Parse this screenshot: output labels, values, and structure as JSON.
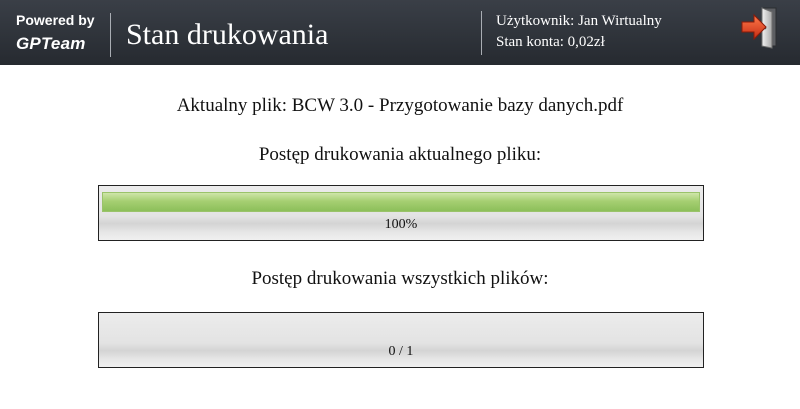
{
  "header": {
    "powered_by": "Powered by",
    "logo_text": "GPTeam",
    "title": "Stan drukowania",
    "user_line": "Użytkownik: Jan Wirtualny",
    "balance_line": "Stan konta: 0,02zł",
    "exit_icon": "exit-door-icon",
    "exit_icon_colors": {
      "door": "#d4d4d4",
      "arrow": "#e2452a"
    }
  },
  "main": {
    "current_file": "Aktualny plik: BCW 3.0 - Przygotowanie bazy danych.pdf",
    "current_progress_label": "Postęp drukowania aktualnego pliku:",
    "current_progress": {
      "fraction": 1.0,
      "text": "100%",
      "color": "#8cbf5a"
    },
    "all_progress_label": "Postęp drukowania wszystkich plików:",
    "all_progress": {
      "fraction": 0.0,
      "text": "0 / 1"
    }
  }
}
